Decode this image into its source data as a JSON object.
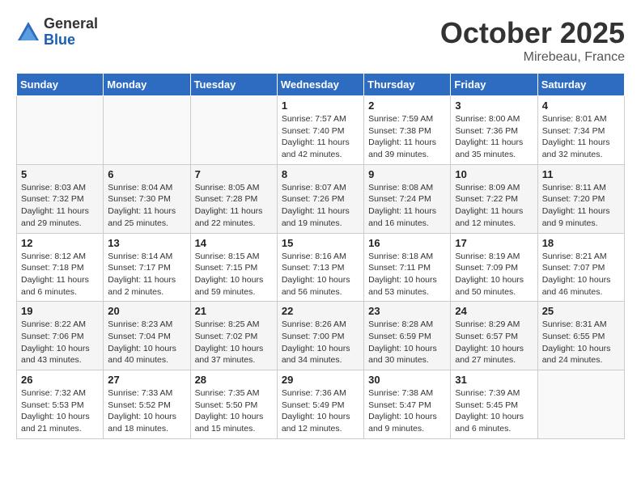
{
  "header": {
    "logo_general": "General",
    "logo_blue": "Blue",
    "month": "October 2025",
    "location": "Mirebeau, France"
  },
  "days_of_week": [
    "Sunday",
    "Monday",
    "Tuesday",
    "Wednesday",
    "Thursday",
    "Friday",
    "Saturday"
  ],
  "weeks": [
    [
      {
        "day": "",
        "info": ""
      },
      {
        "day": "",
        "info": ""
      },
      {
        "day": "",
        "info": ""
      },
      {
        "day": "1",
        "info": "Sunrise: 7:57 AM\nSunset: 7:40 PM\nDaylight: 11 hours and 42 minutes."
      },
      {
        "day": "2",
        "info": "Sunrise: 7:59 AM\nSunset: 7:38 PM\nDaylight: 11 hours and 39 minutes."
      },
      {
        "day": "3",
        "info": "Sunrise: 8:00 AM\nSunset: 7:36 PM\nDaylight: 11 hours and 35 minutes."
      },
      {
        "day": "4",
        "info": "Sunrise: 8:01 AM\nSunset: 7:34 PM\nDaylight: 11 hours and 32 minutes."
      }
    ],
    [
      {
        "day": "5",
        "info": "Sunrise: 8:03 AM\nSunset: 7:32 PM\nDaylight: 11 hours and 29 minutes."
      },
      {
        "day": "6",
        "info": "Sunrise: 8:04 AM\nSunset: 7:30 PM\nDaylight: 11 hours and 25 minutes."
      },
      {
        "day": "7",
        "info": "Sunrise: 8:05 AM\nSunset: 7:28 PM\nDaylight: 11 hours and 22 minutes."
      },
      {
        "day": "8",
        "info": "Sunrise: 8:07 AM\nSunset: 7:26 PM\nDaylight: 11 hours and 19 minutes."
      },
      {
        "day": "9",
        "info": "Sunrise: 8:08 AM\nSunset: 7:24 PM\nDaylight: 11 hours and 16 minutes."
      },
      {
        "day": "10",
        "info": "Sunrise: 8:09 AM\nSunset: 7:22 PM\nDaylight: 11 hours and 12 minutes."
      },
      {
        "day": "11",
        "info": "Sunrise: 8:11 AM\nSunset: 7:20 PM\nDaylight: 11 hours and 9 minutes."
      }
    ],
    [
      {
        "day": "12",
        "info": "Sunrise: 8:12 AM\nSunset: 7:18 PM\nDaylight: 11 hours and 6 minutes."
      },
      {
        "day": "13",
        "info": "Sunrise: 8:14 AM\nSunset: 7:17 PM\nDaylight: 11 hours and 2 minutes."
      },
      {
        "day": "14",
        "info": "Sunrise: 8:15 AM\nSunset: 7:15 PM\nDaylight: 10 hours and 59 minutes."
      },
      {
        "day": "15",
        "info": "Sunrise: 8:16 AM\nSunset: 7:13 PM\nDaylight: 10 hours and 56 minutes."
      },
      {
        "day": "16",
        "info": "Sunrise: 8:18 AM\nSunset: 7:11 PM\nDaylight: 10 hours and 53 minutes."
      },
      {
        "day": "17",
        "info": "Sunrise: 8:19 AM\nSunset: 7:09 PM\nDaylight: 10 hours and 50 minutes."
      },
      {
        "day": "18",
        "info": "Sunrise: 8:21 AM\nSunset: 7:07 PM\nDaylight: 10 hours and 46 minutes."
      }
    ],
    [
      {
        "day": "19",
        "info": "Sunrise: 8:22 AM\nSunset: 7:06 PM\nDaylight: 10 hours and 43 minutes."
      },
      {
        "day": "20",
        "info": "Sunrise: 8:23 AM\nSunset: 7:04 PM\nDaylight: 10 hours and 40 minutes."
      },
      {
        "day": "21",
        "info": "Sunrise: 8:25 AM\nSunset: 7:02 PM\nDaylight: 10 hours and 37 minutes."
      },
      {
        "day": "22",
        "info": "Sunrise: 8:26 AM\nSunset: 7:00 PM\nDaylight: 10 hours and 34 minutes."
      },
      {
        "day": "23",
        "info": "Sunrise: 8:28 AM\nSunset: 6:59 PM\nDaylight: 10 hours and 30 minutes."
      },
      {
        "day": "24",
        "info": "Sunrise: 8:29 AM\nSunset: 6:57 PM\nDaylight: 10 hours and 27 minutes."
      },
      {
        "day": "25",
        "info": "Sunrise: 8:31 AM\nSunset: 6:55 PM\nDaylight: 10 hours and 24 minutes."
      }
    ],
    [
      {
        "day": "26",
        "info": "Sunrise: 7:32 AM\nSunset: 5:53 PM\nDaylight: 10 hours and 21 minutes."
      },
      {
        "day": "27",
        "info": "Sunrise: 7:33 AM\nSunset: 5:52 PM\nDaylight: 10 hours and 18 minutes."
      },
      {
        "day": "28",
        "info": "Sunrise: 7:35 AM\nSunset: 5:50 PM\nDaylight: 10 hours and 15 minutes."
      },
      {
        "day": "29",
        "info": "Sunrise: 7:36 AM\nSunset: 5:49 PM\nDaylight: 10 hours and 12 minutes."
      },
      {
        "day": "30",
        "info": "Sunrise: 7:38 AM\nSunset: 5:47 PM\nDaylight: 10 hours and 9 minutes."
      },
      {
        "day": "31",
        "info": "Sunrise: 7:39 AM\nSunset: 5:45 PM\nDaylight: 10 hours and 6 minutes."
      },
      {
        "day": "",
        "info": ""
      }
    ]
  ]
}
